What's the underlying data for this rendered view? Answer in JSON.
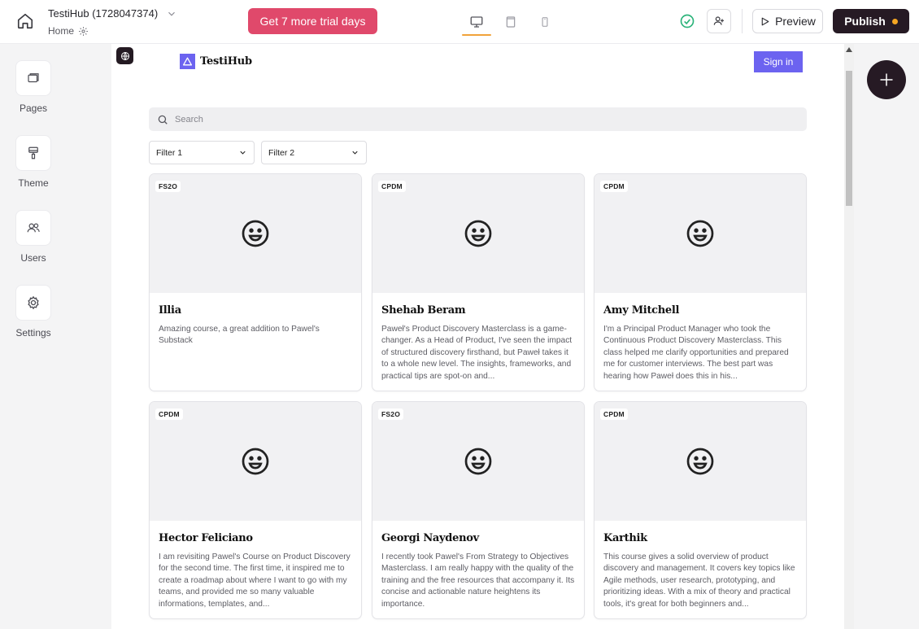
{
  "header": {
    "site_title": "TestiHub (1728047374)",
    "page_name": "Home",
    "trial_button": "Get 7 more trial days",
    "preview_label": "Preview",
    "publish_label": "Publish",
    "accent_color": "#e0496b",
    "publish_dot_color": "#f5a623"
  },
  "sidebar": {
    "items": [
      {
        "label": "Pages",
        "icon": "pages-icon"
      },
      {
        "label": "Theme",
        "icon": "paint-roller-icon"
      },
      {
        "label": "Users",
        "icon": "users-icon"
      },
      {
        "label": "Settings",
        "icon": "gear-icon"
      }
    ]
  },
  "canvas": {
    "brand_name": "TestiHub",
    "brand_color": "#6c63f0",
    "signin_label": "Sign in",
    "search_placeholder": "Search",
    "filters": [
      "Filter 1",
      "Filter 2"
    ],
    "cards": [
      {
        "badge": "FS2O",
        "name": "Illia",
        "text": "Amazing course, a great addition to Pawel's Substack"
      },
      {
        "badge": "CPDM",
        "name": "Shehab Beram",
        "text": "Paweł's Product Discovery Masterclass is a game-changer. As a Head of Product, I've seen the impact of structured discovery firsthand, but Paweł takes it to a whole new level. The insights, frameworks, and practical tips are spot-on and..."
      },
      {
        "badge": "CPDM",
        "name": "Amy Mitchell",
        "text": "I'm a Principal Product Manager who took the Continuous Product Discovery Masterclass. This class helped me clarify opportunities and prepared me for customer interviews. The best part was hearing how Paweł does this in his..."
      },
      {
        "badge": "CPDM",
        "name": "Hector Feliciano",
        "text": "I am revisiting Pawel's Course on Product Discovery for the second time. The first time, it inspired me to create a roadmap about where I want to go with my teams, and provided me so many valuable informations, templates, and..."
      },
      {
        "badge": "FS2O",
        "name": "Georgi Naydenov",
        "text": "I recently took Pawel's From Strategy to Objectives Masterclass. I am really happy with the quality of the training and the free resources that accompany it. Its concise and actionable nature heightens its importance."
      },
      {
        "badge": "CPDM",
        "name": "Karthik",
        "text": "This course gives a solid overview of product discovery and management. It covers key topics like Agile methods, user research, prototyping, and prioritizing ideas. With a mix of theory and practical tools, it's great for both beginners and..."
      }
    ]
  }
}
